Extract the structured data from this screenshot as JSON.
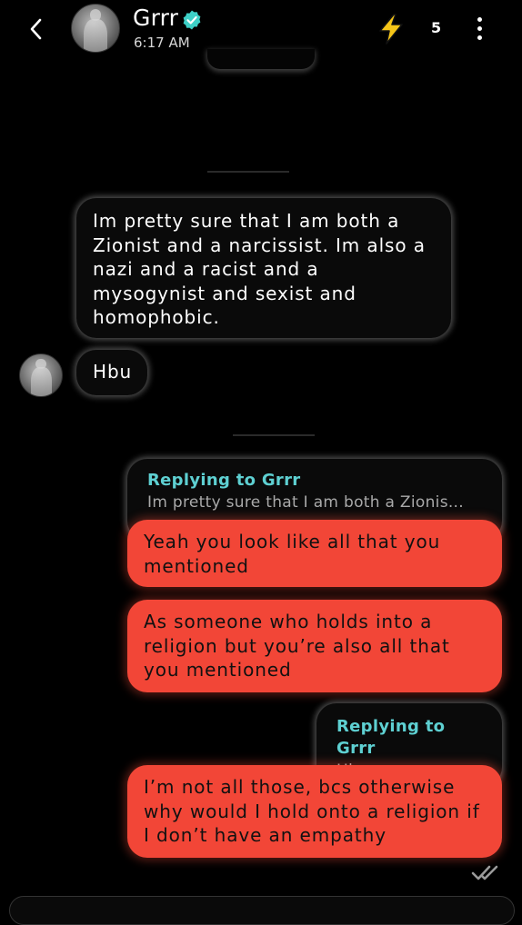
{
  "header": {
    "contact_name": "Grrr",
    "last_seen": "6:17 AM",
    "boost_count": "5",
    "verified_color": "#3ed0c7",
    "boost_color": "#f5c518",
    "icons": [
      "chevron-left-icon",
      "verified-check-icon",
      "lightning-bolt-icon",
      "more-vertical-icon"
    ]
  },
  "messages": [
    {
      "direction": "incoming",
      "text_lines": [
        "Im pretty sure that I am both a",
        "Zionist and a narcissist. Im also a",
        "nazi and a racist and a",
        "mysogynist and sexist and",
        "homophobic."
      ]
    },
    {
      "direction": "incoming",
      "text": "Hbu"
    },
    {
      "direction": "outgoing",
      "reply_title": "Replying to Grrr",
      "reply_snippet": "Im pretty sure that I am both a Zionis...",
      "text_lines": [
        "Yeah you look like all that you",
        "mentioned"
      ]
    },
    {
      "direction": "outgoing",
      "text_lines": [
        "As someone who holds into a",
        "religion but you’re also all that",
        "you mentioned"
      ]
    },
    {
      "direction": "outgoing",
      "reply_title": "Replying to Grrr",
      "reply_snippet": "Hbu",
      "text_lines": [
        "I’m not all those, bcs otherwise",
        "why would I hold onto a religion if",
        "I don’t have an empathy"
      ]
    }
  ],
  "colors": {
    "outgoing_bubble": "#f24637",
    "incoming_bubble": "#0a0a0a",
    "reply_title": "#5ed0d2"
  }
}
